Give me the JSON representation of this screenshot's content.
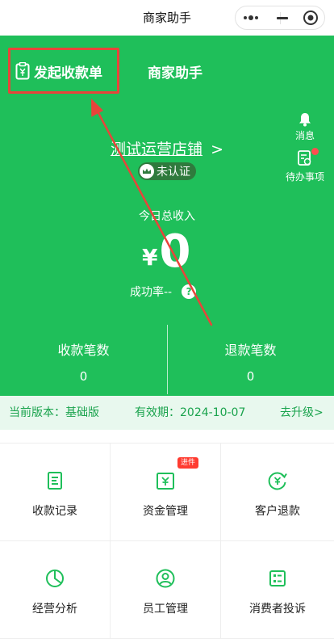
{
  "topbar": {
    "title": "商家助手"
  },
  "nav": {
    "create_label": "发起收款单",
    "merchant_label": "商家助手"
  },
  "side": {
    "messages_label": "消息",
    "todo_label": "待办事项"
  },
  "store": {
    "name": "测试运营店铺",
    "chevron": ">",
    "cert_label": "未认证"
  },
  "income": {
    "label": "今日总收入",
    "currency": "¥",
    "value": "0",
    "success_rate_label": "成功率--",
    "help_glyph": "?"
  },
  "stats": [
    {
      "label": "收款笔数",
      "value": "0"
    },
    {
      "label": "退款笔数",
      "value": "0"
    }
  ],
  "version": {
    "current": "当前版本：基础版",
    "expiry": "有效期：2024-10-07",
    "upgrade": "去升级>"
  },
  "features": [
    {
      "label": "收款记录",
      "icon": "receipt-icon"
    },
    {
      "label": "资金管理",
      "icon": "yen-box-icon",
      "badge": "进件"
    },
    {
      "label": "客户退款",
      "icon": "refund-icon"
    },
    {
      "label": "经营分析",
      "icon": "pie-chart-icon"
    },
    {
      "label": "员工管理",
      "icon": "staff-icon"
    },
    {
      "label": "消费者投诉",
      "icon": "complaint-icon"
    }
  ],
  "colors": {
    "brand_green": "#1fbf5a",
    "highlight_red": "#e8443a",
    "version_bg": "#e8f8ee"
  }
}
